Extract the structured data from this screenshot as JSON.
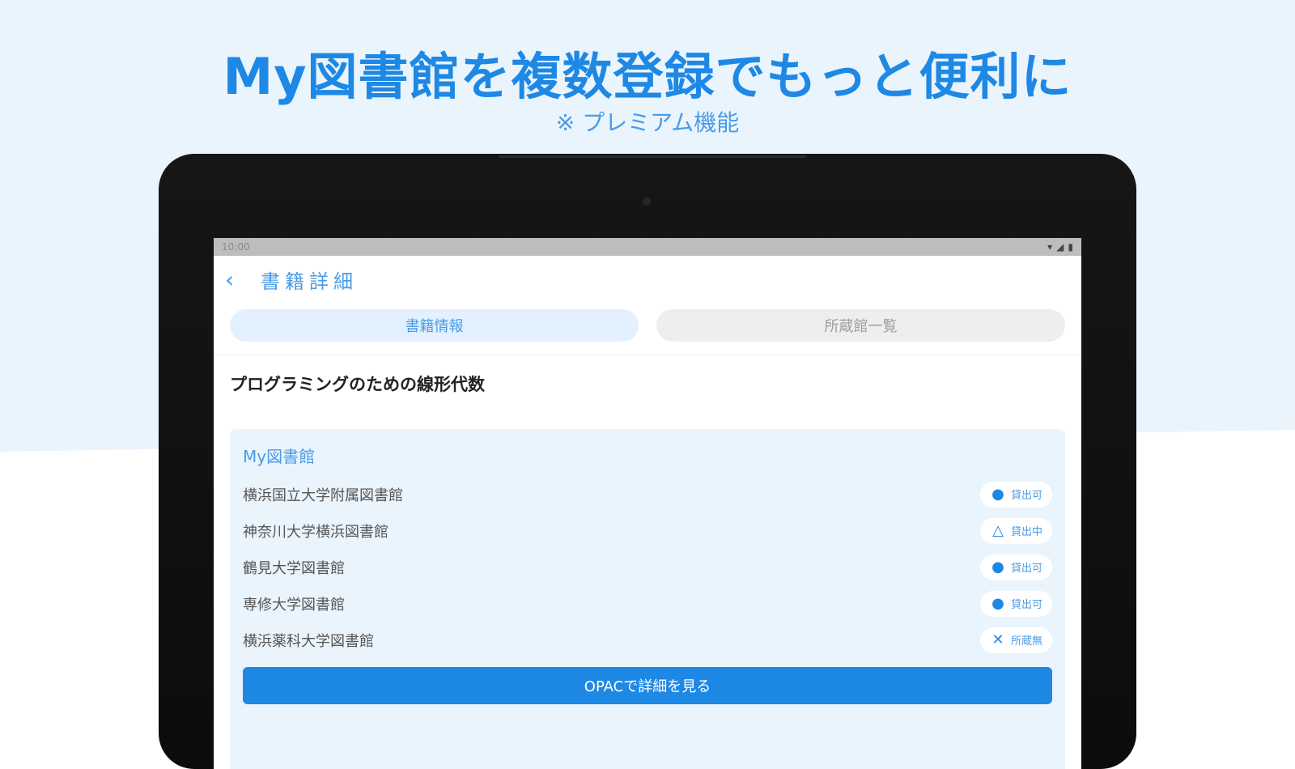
{
  "promo": {
    "headline": "My図書館を複数登録でもっと便利に",
    "subline": "※ プレミアム機能"
  },
  "status_bar": {
    "time": "10:00",
    "icons": [
      "wifi-icon",
      "signal-icon",
      "battery-icon"
    ]
  },
  "app_bar": {
    "back_icon": "chevron-left-icon",
    "title": "書籍詳細"
  },
  "tabs": [
    {
      "label": "書籍情報",
      "active": true
    },
    {
      "label": "所蔵館一覧",
      "active": false
    }
  ],
  "book": {
    "title": "プログラミングのための線形代数"
  },
  "my_library": {
    "title": "My図書館",
    "libraries": [
      {
        "name": "横浜国立大学附属図書館",
        "status": "貸出可",
        "icon": "circle-icon"
      },
      {
        "name": "神奈川大学横浜図書館",
        "status": "貸出中",
        "icon": "triangle-icon"
      },
      {
        "name": "鶴見大学図書館",
        "status": "貸出可",
        "icon": "circle-icon"
      },
      {
        "name": "専修大学図書館",
        "status": "貸出可",
        "icon": "circle-icon"
      },
      {
        "name": "横浜薬科大学図書館",
        "status": "所蔵無",
        "icon": "cross-icon"
      }
    ],
    "button_label": "OPACで詳細を見る"
  },
  "colors": {
    "accent": "#1e88e5",
    "accent_light": "#4a9be6",
    "background_tint": "#eaf4fd"
  }
}
